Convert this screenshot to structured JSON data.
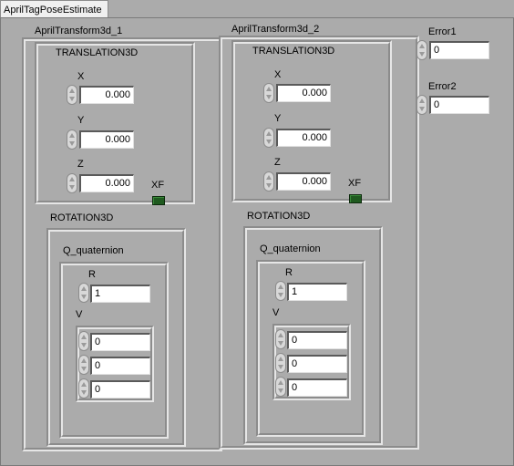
{
  "window": {
    "tab_title": "AprilTagPoseEstimate"
  },
  "cluster1": {
    "title": "AprilTransform3d_1",
    "translation": {
      "title": "TRANSLATION3D",
      "x_label": "X",
      "x": "0.000",
      "y_label": "Y",
      "y": "0.000",
      "z_label": "Z",
      "z": "0.000"
    },
    "xf_label": "XF",
    "rotation": {
      "title": "ROTATION3D",
      "quaternion": {
        "title": "Q_quaternion",
        "r_label": "R",
        "r": "1",
        "v_label": "V",
        "v": [
          "0",
          "0",
          "0"
        ]
      }
    }
  },
  "cluster2": {
    "title": "AprilTransform3d_2",
    "translation": {
      "title": "TRANSLATION3D",
      "x_label": "X",
      "x": "0.000",
      "y_label": "Y",
      "y": "0.000",
      "z_label": "Z",
      "z": "0.000"
    },
    "xf_label": "XF",
    "rotation": {
      "title": "ROTATION3D",
      "quaternion": {
        "title": "Q_quaternion",
        "r_label": "R",
        "r": "1",
        "v_label": "V",
        "v": [
          "0",
          "0",
          "0"
        ]
      }
    }
  },
  "error1": {
    "label": "Error1",
    "value": "0"
  },
  "error2": {
    "label": "Error2",
    "value": "0"
  },
  "colors": {
    "background": "#ababab",
    "led_off": "#1f5a1f"
  }
}
